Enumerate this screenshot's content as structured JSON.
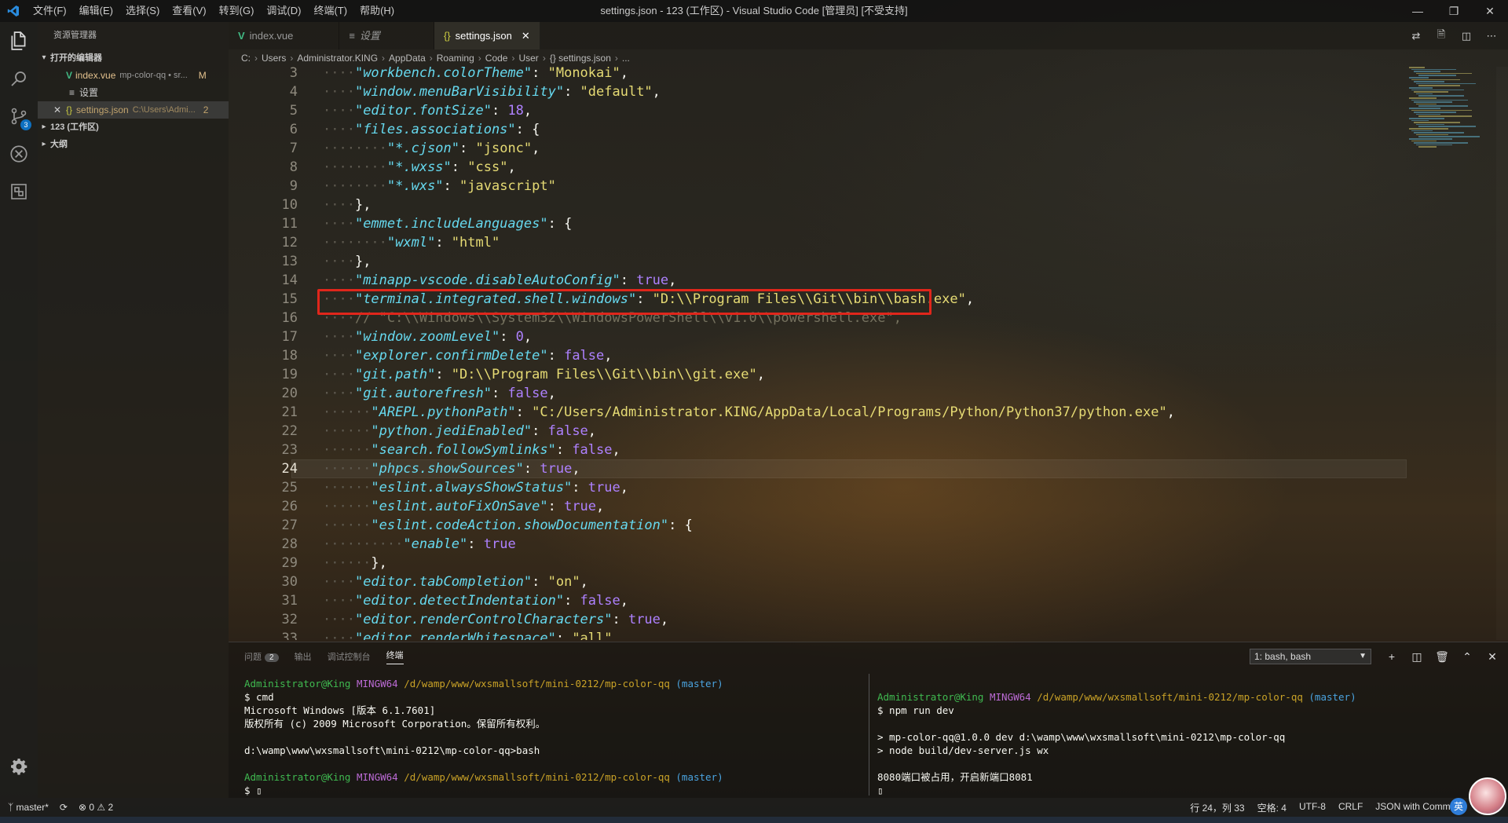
{
  "titlebar": {
    "menus": [
      "文件(F)",
      "编辑(E)",
      "选择(S)",
      "查看(V)",
      "转到(G)",
      "调试(D)",
      "终端(T)",
      "帮助(H)"
    ],
    "title": "settings.json - 123 (工作区) - Visual Studio Code [管理员] [不受支持]"
  },
  "activitybar": {
    "items": [
      "explorer-icon",
      "search-icon",
      "source-control-icon",
      "debug-icon",
      "extensions-icon"
    ],
    "scm_badge": "3"
  },
  "sidebar": {
    "title": "资源管理器",
    "open_editors_label": "打开的编辑器",
    "open_editors": [
      {
        "name": "index.vue",
        "detail": "mp-color-qq • sr...",
        "status": "M"
      },
      {
        "name": "设置",
        "detail": "",
        "status": ""
      },
      {
        "name": "settings.json",
        "detail": "C:\\Users\\Admi...",
        "status": "2"
      }
    ],
    "workspace_label": "123 (工作区)",
    "outline_label": "大纲"
  },
  "tabs": [
    {
      "label": "index.vue",
      "icon": "vue-icon",
      "active": false
    },
    {
      "label": "设置",
      "icon": "settings-icon",
      "active": false
    },
    {
      "label": "settings.json",
      "icon": "json-icon",
      "active": true
    }
  ],
  "breadcrumb": [
    "C:",
    "Users",
    "Administrator.KING",
    "AppData",
    "Roaming",
    "Code",
    "User",
    "{} settings.json",
    "..."
  ],
  "editor": {
    "current_line": 24,
    "lines": [
      {
        "n": "3",
        "indent": 1,
        "parts": [
          [
            "k",
            "\"workbench.colorTheme\""
          ],
          [
            "p",
            ": "
          ],
          [
            "s",
            "\"Monokai\""
          ],
          [
            "p",
            ","
          ]
        ]
      },
      {
        "n": "4",
        "indent": 1,
        "parts": [
          [
            "k",
            "\"window.menuBarVisibility\""
          ],
          [
            "p",
            ": "
          ],
          [
            "s",
            "\"default\""
          ],
          [
            "p",
            ","
          ]
        ]
      },
      {
        "n": "5",
        "indent": 1,
        "parts": [
          [
            "k",
            "\"editor.fontSize\""
          ],
          [
            "p",
            ": "
          ],
          [
            "n",
            "18"
          ],
          [
            "p",
            ","
          ]
        ]
      },
      {
        "n": "6",
        "indent": 1,
        "parts": [
          [
            "k",
            "\"files.associations\""
          ],
          [
            "p",
            ": {"
          ]
        ]
      },
      {
        "n": "7",
        "indent": 2,
        "parts": [
          [
            "k",
            "\"*.cjson\""
          ],
          [
            "p",
            ": "
          ],
          [
            "s",
            "\"jsonc\""
          ],
          [
            "p",
            ","
          ]
        ]
      },
      {
        "n": "8",
        "indent": 2,
        "parts": [
          [
            "k",
            "\"*.wxss\""
          ],
          [
            "p",
            ": "
          ],
          [
            "s",
            "\"css\""
          ],
          [
            "p",
            ","
          ]
        ]
      },
      {
        "n": "9",
        "indent": 2,
        "parts": [
          [
            "k",
            "\"*.wxs\""
          ],
          [
            "p",
            ": "
          ],
          [
            "s",
            "\"javascript\""
          ]
        ]
      },
      {
        "n": "10",
        "indent": 1,
        "parts": [
          [
            "p",
            "},"
          ]
        ]
      },
      {
        "n": "11",
        "indent": 1,
        "parts": [
          [
            "k",
            "\"emmet.includeLanguages\""
          ],
          [
            "p",
            ": {"
          ]
        ]
      },
      {
        "n": "12",
        "indent": 2,
        "parts": [
          [
            "k",
            "\"wxml\""
          ],
          [
            "p",
            ": "
          ],
          [
            "s",
            "\"html\""
          ]
        ]
      },
      {
        "n": "13",
        "indent": 1,
        "parts": [
          [
            "p",
            "},"
          ]
        ]
      },
      {
        "n": "14",
        "indent": 1,
        "parts": [
          [
            "k",
            "\"minapp-vscode.disableAutoConfig\""
          ],
          [
            "p",
            ": "
          ],
          [
            "n",
            "true"
          ],
          [
            "p",
            ","
          ]
        ]
      },
      {
        "n": "15",
        "indent": 1,
        "parts": [
          [
            "k",
            "\"terminal.integrated.shell.windows\""
          ],
          [
            "p",
            ": "
          ],
          [
            "s",
            "\"D:\\\\Program Files\\\\Git\\\\bin\\\\bash.exe\""
          ],
          [
            "p",
            ","
          ]
        ]
      },
      {
        "n": "16",
        "indent": 1,
        "parts": [
          [
            "c",
            "// \"C:\\\\Windows\\\\System32\\\\WindowsPowerShell\\\\v1.0\\\\powershell.exe\","
          ]
        ]
      },
      {
        "n": "17",
        "indent": 1,
        "parts": [
          [
            "k",
            "\"window.zoomLevel\""
          ],
          [
            "p",
            ": "
          ],
          [
            "n",
            "0"
          ],
          [
            "p",
            ","
          ]
        ]
      },
      {
        "n": "18",
        "indent": 1,
        "parts": [
          [
            "k",
            "\"explorer.confirmDelete\""
          ],
          [
            "p",
            ": "
          ],
          [
            "n",
            "false"
          ],
          [
            "p",
            ","
          ]
        ]
      },
      {
        "n": "19",
        "indent": 1,
        "parts": [
          [
            "k",
            "\"git.path\""
          ],
          [
            "p",
            ": "
          ],
          [
            "s",
            "\"D:\\\\Program Files\\\\Git\\\\bin\\\\git.exe\""
          ],
          [
            "p",
            ","
          ]
        ]
      },
      {
        "n": "20",
        "indent": 1,
        "parts": [
          [
            "k",
            "\"git.autorefresh\""
          ],
          [
            "p",
            ": "
          ],
          [
            "n",
            "false"
          ],
          [
            "p",
            ","
          ]
        ]
      },
      {
        "n": "21",
        "indent": 1.5,
        "parts": [
          [
            "k",
            "\"AREPL.pythonPath\""
          ],
          [
            "p",
            ": "
          ],
          [
            "s",
            "\"C:/Users/Administrator.KING/AppData/Local/Programs/Python/Python37/python.exe\""
          ],
          [
            "p",
            ","
          ]
        ]
      },
      {
        "n": "22",
        "indent": 1.5,
        "parts": [
          [
            "k",
            "\"python.jediEnabled\""
          ],
          [
            "p",
            ": "
          ],
          [
            "n",
            "false"
          ],
          [
            "p",
            ","
          ]
        ]
      },
      {
        "n": "23",
        "indent": 1.5,
        "parts": [
          [
            "k",
            "\"search.followSymlinks\""
          ],
          [
            "p",
            ": "
          ],
          [
            "n",
            "false"
          ],
          [
            "p",
            ","
          ]
        ]
      },
      {
        "n": "24",
        "indent": 1.5,
        "parts": [
          [
            "k",
            "\"phpcs.showSources\""
          ],
          [
            "p",
            ": "
          ],
          [
            "n",
            "true"
          ],
          [
            "p",
            ","
          ]
        ]
      },
      {
        "n": "25",
        "indent": 1.5,
        "parts": [
          [
            "k",
            "\"eslint.alwaysShowStatus\""
          ],
          [
            "p",
            ": "
          ],
          [
            "n",
            "true"
          ],
          [
            "p",
            ","
          ]
        ]
      },
      {
        "n": "26",
        "indent": 1.5,
        "parts": [
          [
            "k",
            "\"eslint.autoFixOnSave\""
          ],
          [
            "p",
            ": "
          ],
          [
            "n",
            "true"
          ],
          [
            "p",
            ","
          ]
        ]
      },
      {
        "n": "27",
        "indent": 1.5,
        "parts": [
          [
            "k",
            "\"eslint.codeAction.showDocumentation\""
          ],
          [
            "p",
            ": {"
          ]
        ]
      },
      {
        "n": "28",
        "indent": 2.5,
        "parts": [
          [
            "k",
            "\"enable\""
          ],
          [
            "p",
            ": "
          ],
          [
            "n",
            "true"
          ]
        ]
      },
      {
        "n": "29",
        "indent": 1.5,
        "parts": [
          [
            "p",
            "},"
          ]
        ]
      },
      {
        "n": "30",
        "indent": 1,
        "parts": [
          [
            "k",
            "\"editor.tabCompletion\""
          ],
          [
            "p",
            ": "
          ],
          [
            "s",
            "\"on\""
          ],
          [
            "p",
            ","
          ]
        ]
      },
      {
        "n": "31",
        "indent": 1,
        "parts": [
          [
            "k",
            "\"editor.detectIndentation\""
          ],
          [
            "p",
            ": "
          ],
          [
            "n",
            "false"
          ],
          [
            "p",
            ","
          ]
        ]
      },
      {
        "n": "32",
        "indent": 1,
        "parts": [
          [
            "k",
            "\"editor.renderControlCharacters\""
          ],
          [
            "p",
            ": "
          ],
          [
            "n",
            "true"
          ],
          [
            "p",
            ","
          ]
        ]
      },
      {
        "n": "33",
        "indent": 1,
        "parts": [
          [
            "k",
            "\"editor.renderWhitespace\""
          ],
          [
            "p",
            ": "
          ],
          [
            "s",
            "\"all\""
          ]
        ]
      }
    ]
  },
  "panel": {
    "tabs": [
      {
        "label": "问题",
        "count": "2",
        "active": false
      },
      {
        "label": "输出",
        "count": "",
        "active": false
      },
      {
        "label": "调试控制台",
        "count": "",
        "active": false
      },
      {
        "label": "终端",
        "count": "",
        "active": true
      }
    ],
    "terminal_select": "1: bash, bash",
    "left_terminal": [
      [
        [
          "tg",
          "Administrator@King "
        ],
        [
          "tm",
          "MINGW64 "
        ],
        [
          "ty",
          "/d/wamp/www/wxsmallsoft/mini-0212/mp-color-qq "
        ],
        [
          "tb",
          "(master)"
        ]
      ],
      [
        [
          "p",
          "$ cmd"
        ]
      ],
      [
        [
          "p",
          "Microsoft Windows [版本 6.1.7601]"
        ]
      ],
      [
        [
          "p",
          "版权所有 (c) 2009 Microsoft Corporation。保留所有权利。"
        ]
      ],
      [
        [
          "p",
          ""
        ]
      ],
      [
        [
          "p",
          "d:\\wamp\\www\\wxsmallsoft\\mini-0212\\mp-color-qq>bash"
        ]
      ],
      [
        [
          "p",
          ""
        ]
      ],
      [
        [
          "tg",
          "Administrator@King "
        ],
        [
          "tm",
          "MINGW64 "
        ],
        [
          "ty",
          "/d/wamp/www/wxsmallsoft/mini-0212/mp-color-qq "
        ],
        [
          "tb",
          "(master)"
        ]
      ],
      [
        [
          "p",
          "$ ▯"
        ]
      ]
    ],
    "right_terminal": [
      [
        [
          "p",
          ""
        ]
      ],
      [
        [
          "tg",
          "Administrator@King "
        ],
        [
          "tm",
          "MINGW64 "
        ],
        [
          "ty",
          "/d/wamp/www/wxsmallsoft/mini-0212/mp-color-qq "
        ],
        [
          "tb",
          "(master)"
        ]
      ],
      [
        [
          "p",
          "$ npm run dev"
        ]
      ],
      [
        [
          "p",
          ""
        ]
      ],
      [
        [
          "p",
          "> mp-color-qq@1.0.0 dev d:\\wamp\\www\\wxsmallsoft\\mini-0212\\mp-color-qq"
        ]
      ],
      [
        [
          "p",
          "> node build/dev-server.js wx"
        ]
      ],
      [
        [
          "p",
          ""
        ]
      ],
      [
        [
          "p",
          "8080端口被占用，开启新端口8081"
        ]
      ],
      [
        [
          "p",
          "▯"
        ]
      ]
    ]
  },
  "statusbar": {
    "branch": "master*",
    "errors": "0",
    "warnings": "2",
    "position": "行 24，列 33",
    "spaces": "空格: 4",
    "encoding": "UTF-8",
    "eol": "CRLF",
    "language": "JSON with Commen",
    "ime": "英"
  },
  "colors": {
    "accent": "#0e70c0",
    "keyword": "#66d9ef",
    "string": "#e6db74",
    "constant": "#ae81ff",
    "comment": "#75715e",
    "highlight_box": "#e0261b"
  }
}
